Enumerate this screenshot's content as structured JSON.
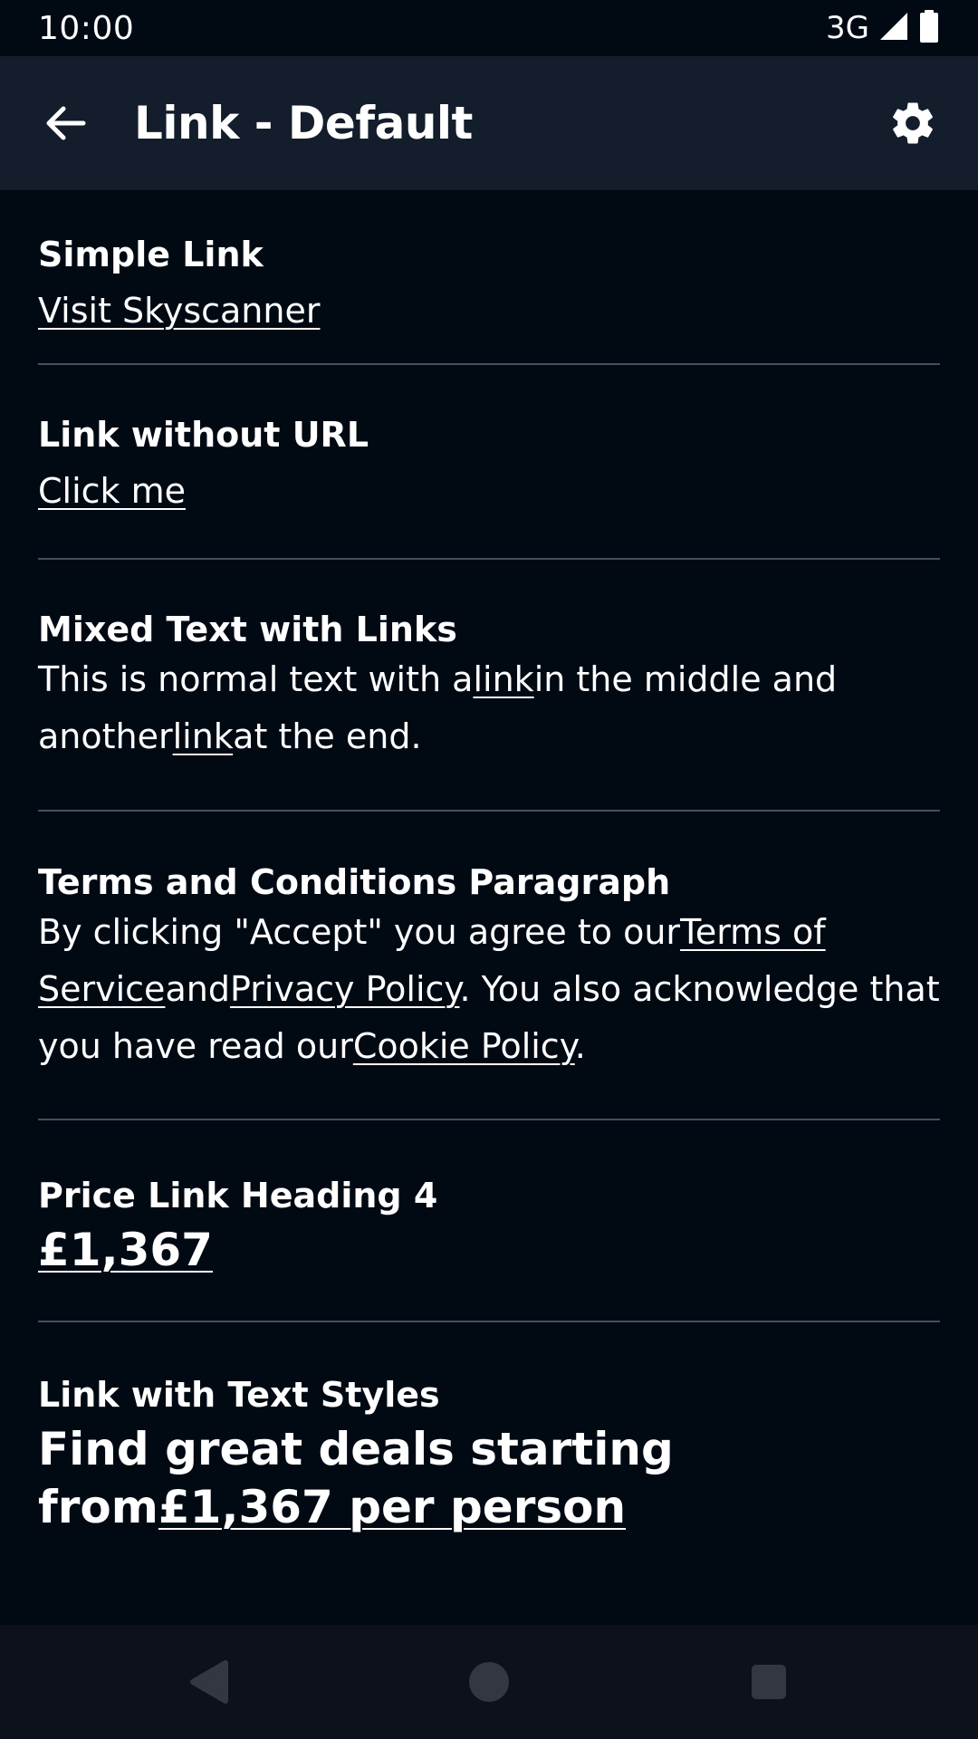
{
  "status_bar": {
    "time": "10:00",
    "network": "3G"
  },
  "app_bar": {
    "title": "Link - Default",
    "back_icon": "arrow-left-icon",
    "settings_icon": "gear-icon"
  },
  "sections": {
    "simple": {
      "title": "Simple Link",
      "link": "Visit Skyscanner"
    },
    "no_url": {
      "title": "Link without URL",
      "link": "Click me"
    },
    "mixed": {
      "title": "Mixed Text with Links",
      "text1": "This is normal text with a",
      "link1": "link",
      "text2": "in the middle and another",
      "link2": "link",
      "text3": "at the end."
    },
    "terms": {
      "title": "Terms and Conditions Paragraph",
      "text1": "By clicking \"Accept\" you agree to our",
      "link1": "Terms of Service",
      "text2": "and",
      "link2": "Privacy Policy",
      "text3": ". You also acknowledge that you have read our",
      "link3": "Cookie Policy",
      "text4": "."
    },
    "price": {
      "title": "Price Link Heading 4",
      "link": "£1,367"
    },
    "styles": {
      "title": "Link with Text Styles",
      "text": "Find great deals starting from",
      "link": "£1,367 per person"
    }
  },
  "nav_bar": {
    "back_icon": "nav-back-icon",
    "home_icon": "nav-home-icon",
    "recents_icon": "nav-recents-icon"
  },
  "colors": {
    "background": "#010913",
    "app_bar": "#131d2b",
    "divider": "#44505e",
    "nav_bar": "#0d111a"
  }
}
